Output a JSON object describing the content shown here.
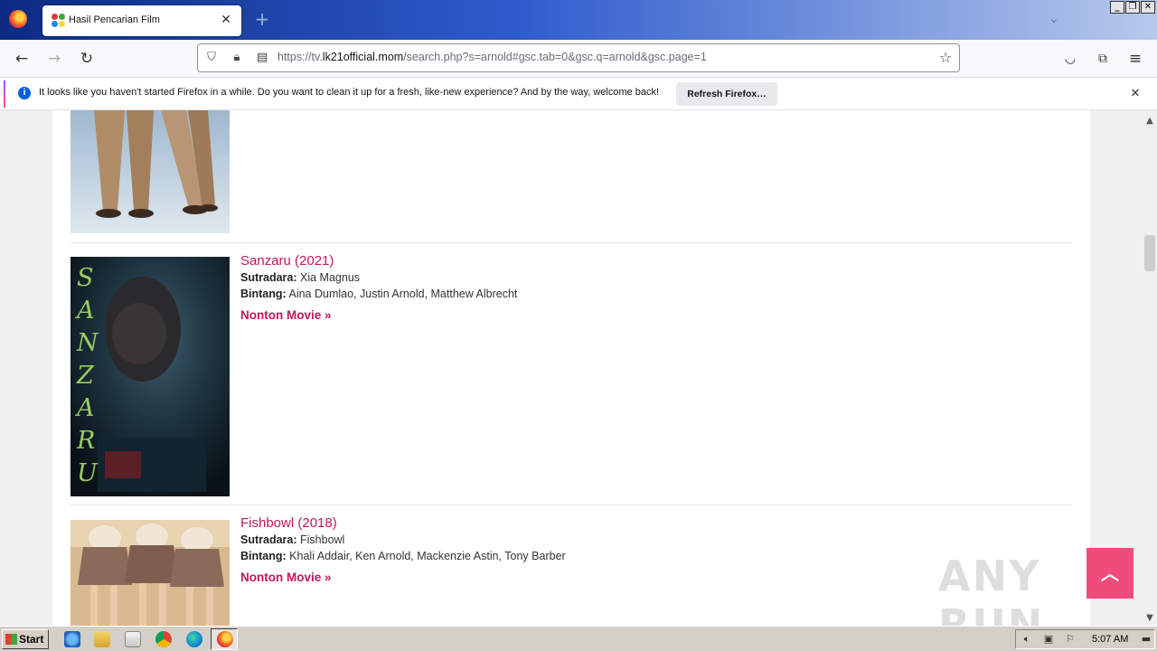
{
  "browser": {
    "tab_title": "Hasil Pencarian Film",
    "url_prefix": "https://tv.",
    "url_domain": "lk21official.mom",
    "url_rest": "/search.php?s=arnold#gsc.tab=0&gsc.q=arnold&gsc.page=1",
    "notification": {
      "message": "It looks like you haven't started Firefox in a while. Do you want to clean it up for a fresh, like-new experience? And by the way, welcome back!",
      "button": "Refresh Firefox…"
    }
  },
  "results": [
    {
      "title": "Sanzaru (2021)",
      "director_label": "Sutradara:",
      "director": "Xia Magnus",
      "cast_label": "Bintang:",
      "cast": "Aina Dumlao, Justin Arnold, Matthew Albrecht",
      "watch_label": "Nonton Movie »",
      "poster_text": [
        "S",
        "A",
        "N",
        "Z",
        "A",
        "R",
        "U"
      ]
    },
    {
      "title": "Fishbowl (2018)",
      "director_label": "Sutradara:",
      "director": "Fishbowl",
      "cast_label": "Bintang:",
      "cast": "Khali Addair, Ken Arnold, Mackenzie Astin, Tony Barber",
      "watch_label": "Nonton Movie »"
    }
  ],
  "watermark": "ANY RUN",
  "taskbar": {
    "start_label": "Start",
    "clock": "5:07 AM"
  },
  "colors": {
    "accent": "#c2185b",
    "to_top_button": "#ef4c7c"
  }
}
